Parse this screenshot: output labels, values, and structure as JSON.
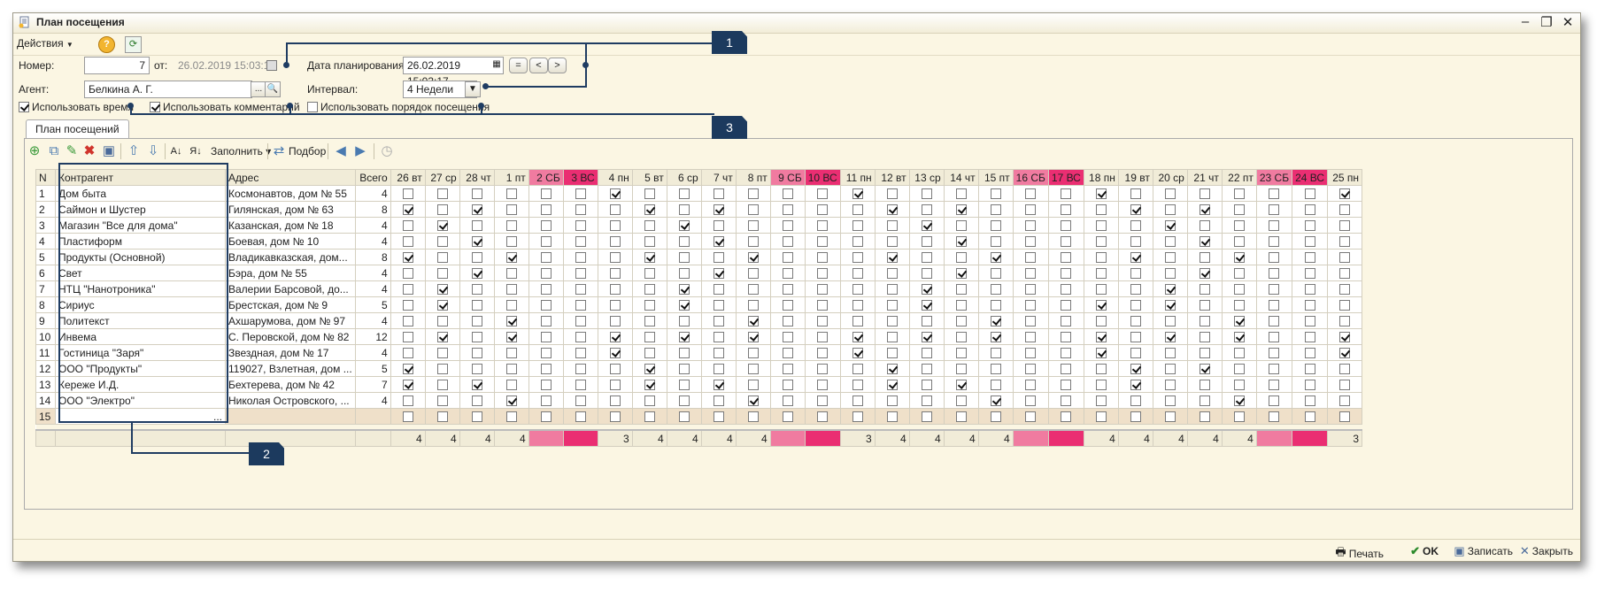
{
  "window": {
    "title": "План посещения"
  },
  "menu": {
    "actions": "Действия",
    "help": "?"
  },
  "form": {
    "number_label": "Номер:",
    "number_value": "7",
    "from_label": "от:",
    "from_date": "26.02.2019 15:03:17",
    "agent_label": "Агент:",
    "agent_value": "Белкина А. Г.",
    "plan_date_label": "Дата планирования:",
    "plan_date_value": "26.02.2019 15:03:17",
    "interval_label": "Интервал:",
    "interval_value": "4 Недели",
    "use_time": "Использовать время",
    "use_comment": "Использовать комментарий",
    "use_order": "Использовать порядок посещения"
  },
  "tab": {
    "label": "План посещений"
  },
  "toolbar": {
    "fill": "Заполнить",
    "select": "Подбор"
  },
  "table": {
    "headers": {
      "n": "N",
      "kontragent": "Контрагент",
      "address": "Адрес",
      "total": "Всего"
    },
    "days": [
      {
        "label": "26 вт",
        "type": "work"
      },
      {
        "label": "27 ср",
        "type": "work"
      },
      {
        "label": "28 чт",
        "type": "work"
      },
      {
        "label": "1 пт",
        "type": "work"
      },
      {
        "label": "2 СБ",
        "type": "sat"
      },
      {
        "label": "3 ВС",
        "type": "sun"
      },
      {
        "label": "4 пн",
        "type": "work"
      },
      {
        "label": "5 вт",
        "type": "work"
      },
      {
        "label": "6 ср",
        "type": "work"
      },
      {
        "label": "7 чт",
        "type": "work"
      },
      {
        "label": "8 пт",
        "type": "work"
      },
      {
        "label": "9 СБ",
        "type": "sat"
      },
      {
        "label": "10 ВС",
        "type": "sun"
      },
      {
        "label": "11 пн",
        "type": "work"
      },
      {
        "label": "12 вт",
        "type": "work"
      },
      {
        "label": "13 ср",
        "type": "work"
      },
      {
        "label": "14 чт",
        "type": "work"
      },
      {
        "label": "15 пт",
        "type": "work"
      },
      {
        "label": "16 СБ",
        "type": "sat"
      },
      {
        "label": "17 ВС",
        "type": "sun"
      },
      {
        "label": "18 пн",
        "type": "work"
      },
      {
        "label": "19 вт",
        "type": "work"
      },
      {
        "label": "20 ср",
        "type": "work"
      },
      {
        "label": "21 чт",
        "type": "work"
      },
      {
        "label": "22 пт",
        "type": "work"
      },
      {
        "label": "23 СБ",
        "type": "sat"
      },
      {
        "label": "24 ВС",
        "type": "sun"
      },
      {
        "label": "25 пн",
        "type": "work"
      }
    ],
    "rows": [
      {
        "n": "1",
        "name": "Дом быта",
        "address": "Космонавтов, дом № 55",
        "total": "4",
        "checks": [
          6,
          13,
          20,
          27
        ]
      },
      {
        "n": "2",
        "name": "Саймон и Шустер",
        "address": "Гилянская, дом № 63",
        "total": "8",
        "checks": [
          0,
          2,
          7,
          9,
          14,
          16,
          21,
          23
        ]
      },
      {
        "n": "3",
        "name": "Магазин \"Все для дома\"",
        "address": "Казанская, дом № 18",
        "total": "4",
        "checks": [
          1,
          8,
          15,
          22
        ]
      },
      {
        "n": "4",
        "name": "Пластиформ",
        "address": "Боевая, дом № 10",
        "total": "4",
        "checks": [
          2,
          9,
          16,
          23
        ]
      },
      {
        "n": "5",
        "name": "Продукты (Основной)",
        "address": "Владикавказская, дом...",
        "total": "8",
        "checks": [
          0,
          3,
          7,
          10,
          14,
          17,
          21,
          24
        ]
      },
      {
        "n": "6",
        "name": "Свет",
        "address": "Бэра, дом № 55",
        "total": "4",
        "checks": [
          2,
          9,
          16,
          23
        ]
      },
      {
        "n": "7",
        "name": "НТЦ \"Нанотроника\"",
        "address": "Валерии Барсовой, до...",
        "total": "4",
        "checks": [
          1,
          8,
          15,
          22
        ]
      },
      {
        "n": "8",
        "name": "Сириус",
        "address": "Брестская, дом № 9",
        "total": "5",
        "checks": [
          1,
          8,
          15,
          20,
          22
        ]
      },
      {
        "n": "9",
        "name": "Политекст",
        "address": "Ахшарумова, дом № 97",
        "total": "4",
        "checks": [
          3,
          10,
          17,
          24
        ]
      },
      {
        "n": "10",
        "name": "Инвема",
        "address": "С. Перовской, дом № 82",
        "total": "12",
        "checks": [
          1,
          3,
          6,
          8,
          10,
          13,
          15,
          17,
          20,
          22,
          24,
          27
        ]
      },
      {
        "n": "11",
        "name": "Гостиница \"Заря\"",
        "address": "Звездная, дом № 17",
        "total": "4",
        "checks": [
          6,
          13,
          20,
          27
        ]
      },
      {
        "n": "12",
        "name": "ООО \"Продукты\"",
        "address": "119027, Взлетная, дом ...",
        "total": "5",
        "checks": [
          0,
          7,
          14,
          21,
          23
        ]
      },
      {
        "n": "13",
        "name": "Кереже И.Д.",
        "address": "Бехтерева, дом № 42",
        "total": "7",
        "checks": [
          0,
          2,
          7,
          9,
          14,
          16,
          21
        ]
      },
      {
        "n": "14",
        "name": "ООО \"Электро\"",
        "address": "Николая Островского, ...",
        "total": "4",
        "checks": [
          3,
          10,
          17,
          24
        ]
      }
    ],
    "new_row_n": "15",
    "new_row_btn": "...",
    "totals": [
      "4",
      "4",
      "4",
      "4",
      "",
      "",
      "3",
      "4",
      "4",
      "4",
      "4",
      "",
      "",
      "3",
      "4",
      "4",
      "4",
      "4",
      "",
      "",
      "4",
      "4",
      "4",
      "4",
      "4",
      "",
      "",
      "3"
    ]
  },
  "bottom": {
    "print": "Печать",
    "ok": "OK",
    "save": "Записать",
    "close": "Закрыть"
  },
  "callouts": {
    "c1": "1",
    "c2": "2",
    "c3": "3"
  },
  "colors": {
    "saturday": "#f07ba0",
    "sunday": "#ea2e72",
    "callout": "#1c3a5e",
    "window_bg": "#fbf6e3"
  }
}
